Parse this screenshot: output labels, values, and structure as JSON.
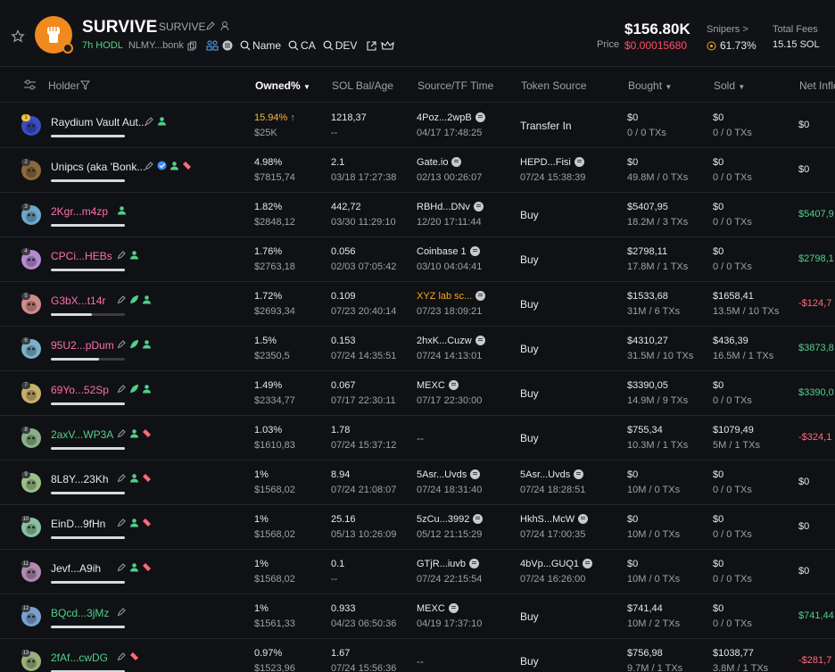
{
  "token": {
    "name": "SURVIVE",
    "ticker": "SURVIVE",
    "age": "7h HODL",
    "address": "NLMY...bonk",
    "links": [
      "Name",
      "CA",
      "DEV"
    ],
    "market_cap": "$156.80K",
    "price_label": "Price",
    "price": "$0.00015680",
    "snipers_label": "Snipers >",
    "snipers_value": "61.73%",
    "fees_label": "Total Fees",
    "fees_value": "15.15 SOL"
  },
  "columns": {
    "holder": "Holder",
    "owned": "Owned%",
    "sol": "SOL Bal/Age",
    "source": "Source/TF Time",
    "token_source": "Token Source",
    "bought": "Bought",
    "sold": "Sold",
    "net": "Net Inflo"
  },
  "rows": [
    {
      "rank": "1",
      "name": "Raydium Vault Aut...",
      "name_color": "#e7e8ec",
      "avatar": "#3b4cc0",
      "bar": 0,
      "owned": "15.94%",
      "owned_color": "#f5b942",
      "up": true,
      "owned_usd": "$25K",
      "sol": "1218,37",
      "age": "--",
      "source": "4Poz...2wpB",
      "source_color": "#e7e8ec",
      "source_pill": true,
      "source_time": "04/17 17:48:25",
      "token_source": "Transfer In",
      "ts_pill": false,
      "ts_time": "",
      "bought": "$0",
      "bought_sub": "0 / 0 TXs",
      "sold": "$0",
      "sold_sub": "0 / 0 TXs",
      "net": "$0",
      "net_color": "#e7e8ec",
      "icons": [
        "edit-icon",
        "user-icon"
      ]
    },
    {
      "rank": "2",
      "name": "Unipcs (aka 'Bonk...",
      "name_color": "#e7e8ec",
      "avatar": "#8a6a3a",
      "bar": 0,
      "owned": "4.98%",
      "owned_color": "#e7e8ec",
      "up": false,
      "owned_usd": "$7815,74",
      "sol": "2.1",
      "age": "03/18 17:27:38",
      "source": "Gate.io",
      "source_color": "#e7e8ec",
      "source_pill": true,
      "source_time": "02/13 00:26:07",
      "token_source": "HEPD...Fisi",
      "ts_pill": true,
      "ts_time": "07/24 15:38:39",
      "bought": "$0",
      "bought_sub": "49.8M / 0 TXs",
      "sold": "$0",
      "sold_sub": "0 / 0 TXs",
      "net": "$0",
      "net_color": "#e7e8ec",
      "icons": [
        "edit-icon",
        "verified-icon",
        "user-icon",
        "tag-icon"
      ]
    },
    {
      "rank": "3",
      "name": "2Kgr...m4zp",
      "name_color": "#ff6fae",
      "avatar": "#6aa9c9",
      "bar": 0,
      "owned": "1.82%",
      "owned_color": "#e7e8ec",
      "up": false,
      "owned_usd": "$2848,12",
      "sol": "442,72",
      "age": "03/30 11:29:10",
      "source": "RBHd...DNv",
      "source_color": "#e7e8ec",
      "source_pill": true,
      "source_time": "12/20 17:11:44",
      "token_source": "Buy",
      "ts_pill": false,
      "ts_time": "",
      "bought": "$5407,95",
      "bought_sub": "18.2M / 3 TXs",
      "sold": "$0",
      "sold_sub": "0 / 0 TXs",
      "net": "$5407,9",
      "net_color": "#4fd18b",
      "icons": [
        "user-icon"
      ]
    },
    {
      "rank": "4",
      "name": "CPCi...HEBs",
      "name_color": "#ff6fae",
      "avatar": "#b58ad0",
      "bar": 0,
      "owned": "1.76%",
      "owned_color": "#e7e8ec",
      "up": false,
      "owned_usd": "$2763,18",
      "sol": "0.056",
      "age": "02/03 07:05:42",
      "source": "Coinbase 1",
      "source_color": "#e7e8ec",
      "source_pill": true,
      "source_time": "03/10 04:04:41",
      "token_source": "Buy",
      "ts_pill": false,
      "ts_time": "",
      "bought": "$2798,11",
      "bought_sub": "17.8M / 1 TXs",
      "sold": "$0",
      "sold_sub": "0 / 0 TXs",
      "net": "$2798,1",
      "net_color": "#4fd18b",
      "icons": [
        "edit-icon",
        "user-icon"
      ]
    },
    {
      "rank": "5",
      "name": "G3bX...t14r",
      "name_color": "#ff6fae",
      "avatar": "#d08a8a",
      "bar": 0.55,
      "owned": "1.72%",
      "owned_color": "#e7e8ec",
      "up": false,
      "owned_usd": "$2693,34",
      "sol": "0.109",
      "age": "07/23 20:40:14",
      "source": "XYZ lab sc...",
      "source_color": "#f5a524",
      "source_pill": true,
      "source_time": "07/23 18:09:21",
      "token_source": "Buy",
      "ts_pill": false,
      "ts_time": "",
      "bought": "$1533,68",
      "bought_sub": "31M / 6 TXs",
      "sold": "$1658,41",
      "sold_sub": "13.5M / 10 TXs",
      "net": "-$124,7",
      "net_color": "#ff6b7a",
      "icons": [
        "edit-icon",
        "leaf-icon",
        "user-icon"
      ]
    },
    {
      "rank": "6",
      "name": "95U2...pDum",
      "name_color": "#ff6fae",
      "avatar": "#7ab0c8",
      "bar": 0.65,
      "owned": "1.5%",
      "owned_color": "#e7e8ec",
      "up": false,
      "owned_usd": "$2350,5",
      "sol": "0.153",
      "age": "07/24 14:35:51",
      "source": "2hxK...Cuzw",
      "source_color": "#e7e8ec",
      "source_pill": true,
      "source_time": "07/24 14:13:01",
      "token_source": "Buy",
      "ts_pill": false,
      "ts_time": "",
      "bought": "$4310,27",
      "bought_sub": "31.5M / 10 TXs",
      "sold": "$436,39",
      "sold_sub": "16.5M / 1 TXs",
      "net": "$3873,8",
      "net_color": "#4fd18b",
      "icons": [
        "edit-icon",
        "leaf-icon",
        "user-icon"
      ]
    },
    {
      "rank": "7",
      "name": "69Yo...52Sp",
      "name_color": "#ff6fae",
      "avatar": "#c8b06a",
      "bar": 0,
      "owned": "1.49%",
      "owned_color": "#e7e8ec",
      "up": false,
      "owned_usd": "$2334,77",
      "sol": "0.067",
      "age": "07/17 22:30:11",
      "source": "MEXC",
      "source_color": "#e7e8ec",
      "source_pill": true,
      "source_time": "07/17 22:30:00",
      "token_source": "Buy",
      "ts_pill": false,
      "ts_time": "",
      "bought": "$3390,05",
      "bought_sub": "14.9M / 9 TXs",
      "sold": "$0",
      "sold_sub": "0 / 0 TXs",
      "net": "$3390,0",
      "net_color": "#4fd18b",
      "icons": [
        "edit-icon",
        "leaf-icon",
        "user-icon"
      ]
    },
    {
      "rank": "8",
      "name": "2axV...WP3A",
      "name_color": "#4fd18b",
      "avatar": "#8ab08a",
      "bar": 0,
      "owned": "1.03%",
      "owned_color": "#e7e8ec",
      "up": false,
      "owned_usd": "$1610,83",
      "sol": "1.78",
      "age": "07/24 15:37:12",
      "source": "--",
      "source_color": "#9ea1a9",
      "source_pill": false,
      "source_time": "",
      "token_source": "Buy",
      "ts_pill": false,
      "ts_time": "",
      "bought": "$755,34",
      "bought_sub": "10.3M / 1 TXs",
      "sold": "$1079,49",
      "sold_sub": "5M / 1 TXs",
      "net": "-$324,1",
      "net_color": "#ff6b7a",
      "icons": [
        "edit-icon",
        "user-icon",
        "tag-icon"
      ]
    },
    {
      "rank": "9",
      "name": "8L8Y...23Kh",
      "name_color": "#e7e8ec",
      "avatar": "#9ac08a",
      "bar": 0,
      "owned": "1%",
      "owned_color": "#e7e8ec",
      "up": false,
      "owned_usd": "$1568,02",
      "sol": "8.94",
      "age": "07/24 21:08:07",
      "source": "5Asr...Uvds",
      "source_color": "#e7e8ec",
      "source_pill": true,
      "source_time": "07/24 18:31:40",
      "token_source": "5Asr...Uvds",
      "ts_pill": true,
      "ts_time": "07/24 18:28:51",
      "bought": "$0",
      "bought_sub": "10M / 0 TXs",
      "sold": "$0",
      "sold_sub": "0 / 0 TXs",
      "net": "$0",
      "net_color": "#e7e8ec",
      "icons": [
        "edit-icon",
        "user-icon",
        "tag-icon"
      ]
    },
    {
      "rank": "10",
      "name": "EinD...9fHn",
      "name_color": "#e7e8ec",
      "avatar": "#8ac0a0",
      "bar": 0,
      "owned": "1%",
      "owned_color": "#e7e8ec",
      "up": false,
      "owned_usd": "$1568,02",
      "sol": "25.16",
      "age": "05/13 10:26:09",
      "source": "5zCu...3992",
      "source_color": "#e7e8ec",
      "source_pill": true,
      "source_time": "05/12 21:15:29",
      "token_source": "HkhS...McW",
      "ts_pill": true,
      "ts_time": "07/24 17:00:35",
      "bought": "$0",
      "bought_sub": "10M / 0 TXs",
      "sold": "$0",
      "sold_sub": "0 / 0 TXs",
      "net": "$0",
      "net_color": "#e7e8ec",
      "icons": [
        "edit-icon",
        "user-icon",
        "tag-icon"
      ]
    },
    {
      "rank": "11",
      "name": "Jevf...A9ih",
      "name_color": "#e7e8ec",
      "avatar": "#b08ab0",
      "bar": 0,
      "owned": "1%",
      "owned_color": "#e7e8ec",
      "up": false,
      "owned_usd": "$1568,02",
      "sol": "0.1",
      "age": "--",
      "source": "GTjR...iuvb",
      "source_color": "#e7e8ec",
      "source_pill": true,
      "source_time": "07/24 22:15:54",
      "token_source": "4bVp...GUQ1",
      "ts_pill": true,
      "ts_time": "07/24 16:26:00",
      "bought": "$0",
      "bought_sub": "10M / 0 TXs",
      "sold": "$0",
      "sold_sub": "0 / 0 TXs",
      "net": "$0",
      "net_color": "#e7e8ec",
      "icons": [
        "edit-icon",
        "user-icon",
        "tag-icon"
      ]
    },
    {
      "rank": "12",
      "name": "BQcd...3jMz",
      "name_color": "#4fd18b",
      "avatar": "#7aa0d0",
      "bar": 0,
      "owned": "1%",
      "owned_color": "#e7e8ec",
      "up": false,
      "owned_usd": "$1561,33",
      "sol": "0.933",
      "age": "04/23 06:50:36",
      "source": "MEXC",
      "source_color": "#e7e8ec",
      "source_pill": true,
      "source_time": "04/19 17:37:10",
      "token_source": "Buy",
      "ts_pill": false,
      "ts_time": "",
      "bought": "$741,44",
      "bought_sub": "10M / 2 TXs",
      "sold": "$0",
      "sold_sub": "0 / 0 TXs",
      "net": "$741,44",
      "net_color": "#4fd18b",
      "icons": [
        "edit-icon"
      ]
    },
    {
      "rank": "13",
      "name": "2fAf...cwDG",
      "name_color": "#4fd18b",
      "avatar": "#9ab07a",
      "bar": 0,
      "owned": "0.97%",
      "owned_color": "#e7e8ec",
      "up": false,
      "owned_usd": "$1523,96",
      "sol": "1.67",
      "age": "07/24 15:56:36",
      "source": "--",
      "source_color": "#9ea1a9",
      "source_pill": false,
      "source_time": "",
      "token_source": "Buy",
      "ts_pill": false,
      "ts_time": "",
      "bought": "$756,98",
      "bought_sub": "9.7M / 1 TXs",
      "sold": "$1038,77",
      "sold_sub": "3.8M / 1 TXs",
      "net": "-$281,7",
      "net_color": "#ff6b7a",
      "icons": [
        "edit-icon",
        "tag-icon"
      ]
    }
  ]
}
